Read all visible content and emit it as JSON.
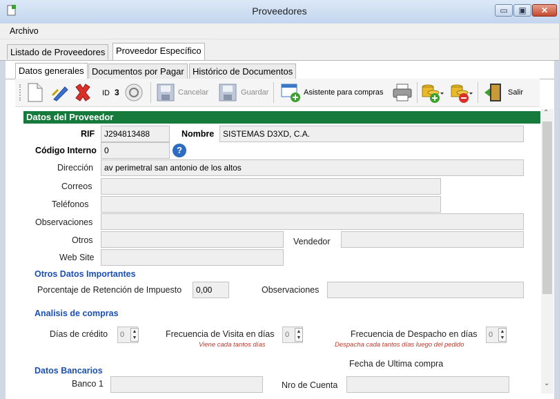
{
  "window": {
    "title": "Proveedores",
    "min_label": "▭",
    "max_label": "▣",
    "close_label": "✕"
  },
  "menu": {
    "archivo": "Archivo"
  },
  "tabs_top": [
    "Listado de Proveedores",
    "Proveedor Específico"
  ],
  "tabs_sub": [
    "Datos generales",
    "Documentos por Pagar",
    "Histórico de Documentos"
  ],
  "toolbar": {
    "id_label": "ID",
    "id_value": "3",
    "cancel_label": "Cancelar",
    "save_label": "Guardar",
    "wizard_label": "Asistente para compras",
    "exit_label": "Salir"
  },
  "section_header": "Datos del Proveedor",
  "form": {
    "rif_label": "RIF",
    "rif_value": "J294813488",
    "nombre_label": "Nombre",
    "nombre_value": "SISTEMAS D3XD, C.A.",
    "codigo_label": "Código Interno",
    "codigo_value": "0",
    "help_glyph": "?",
    "direccion_label": "Dirección",
    "direccion_value": "av perimetral san antonio de los altos",
    "correos_label": "Correos",
    "correos_value": "",
    "telefonos_label": "Teléfonos",
    "telefonos_value": "",
    "observaciones_label": "Observaciones",
    "observaciones_value": "",
    "otros_label": "Otros",
    "otros_value": "",
    "vendedor_label": "Vendedor",
    "vendedor_value": "",
    "website_label": "Web Site",
    "website_value": ""
  },
  "otros_datos": {
    "title": "Otros Datos Importantes",
    "retencion_label": "Porcentaje de Retención de Impuesto",
    "retencion_value": "0,00",
    "observaciones_label": "Observaciones",
    "observaciones_value": ""
  },
  "analisis": {
    "title": "Analisis de compras",
    "credito_label": "Días de crédito",
    "credito_value": "0",
    "visita_label": "Frecuencia de Visita en días",
    "visita_value": "0",
    "visita_hint": "Viene cada tantos días",
    "despacho_label": "Frecuencia de Despacho en días",
    "despacho_value": "0",
    "despacho_hint": "Despacha cada tantos días luego del pedido",
    "ultima_compra_label": "Fecha de Ultima compra"
  },
  "bancarios": {
    "title": "Datos Bancarios",
    "banco1_label": "Banco 1",
    "banco1_value": "",
    "cuenta_label": "Nro de Cuenta",
    "cuenta_value": ""
  },
  "colors": {
    "header_green": "#157a3c",
    "section_blue": "#1a4fb3",
    "hint_red": "#c0392b"
  },
  "icons": [
    "new-document-icon",
    "edit-icon",
    "delete-icon",
    "refresh-icon",
    "cancel-icon",
    "save-icon",
    "wizard-icon",
    "print-icon",
    "add-coins-icon",
    "remove-coins-icon",
    "exit-door-icon",
    "help-icon"
  ]
}
